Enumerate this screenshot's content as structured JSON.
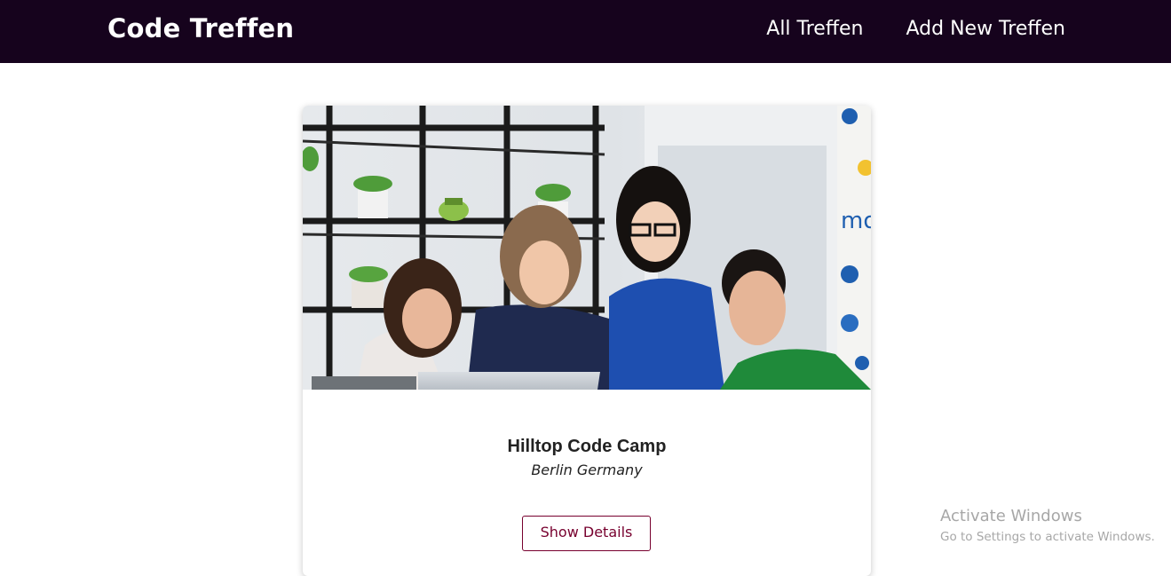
{
  "header": {
    "brand": "Code Treffen",
    "nav": [
      "All Treffen",
      "Add New Treffen"
    ]
  },
  "meetup_card": {
    "title": "Hilltop Code Camp",
    "location": "Berlin Germany",
    "button_label": "Show Details",
    "image_alt": "group-photo"
  },
  "os_watermark": {
    "title": "Activate Windows",
    "subtitle": "Go to Settings to activate Windows."
  },
  "colors": {
    "header_bg": "#16031d",
    "accent": "#77002e",
    "text": "#222222"
  }
}
